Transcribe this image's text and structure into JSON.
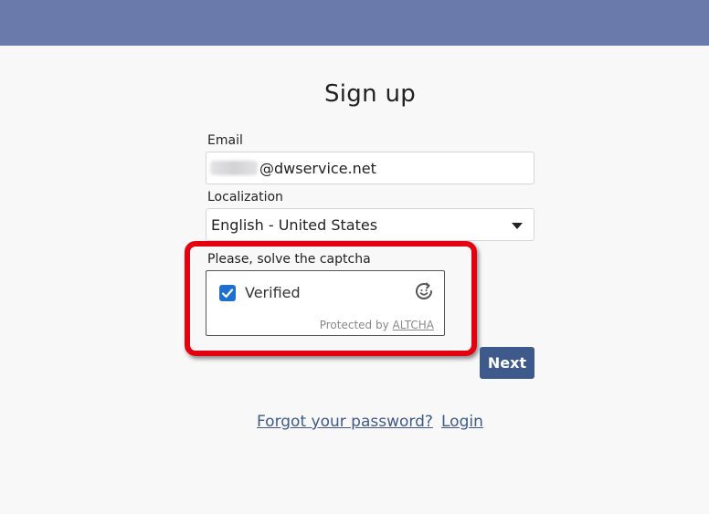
{
  "header": {
    "bar_color": "#6a7aab"
  },
  "page": {
    "title": "Sign up"
  },
  "form": {
    "email": {
      "label": "Email",
      "value_suffix": "@dwservice.net"
    },
    "localization": {
      "label": "Localization",
      "selected": "English - United States"
    },
    "captcha": {
      "label": "Please, solve the captcha",
      "status": "Verified",
      "checked": true,
      "protected_by": "Protected by",
      "provider": "ALTCHA",
      "checkbox_color": "#1f6fd1"
    },
    "next_label": "Next"
  },
  "links": {
    "forgot": "Forgot your password?",
    "login": "Login"
  },
  "annotation": {
    "highlight_color": "#e3000f"
  },
  "icons": {
    "select": "chevron-down-icon",
    "checkbox": "checkmark-icon",
    "refresh": "refresh-icon"
  }
}
